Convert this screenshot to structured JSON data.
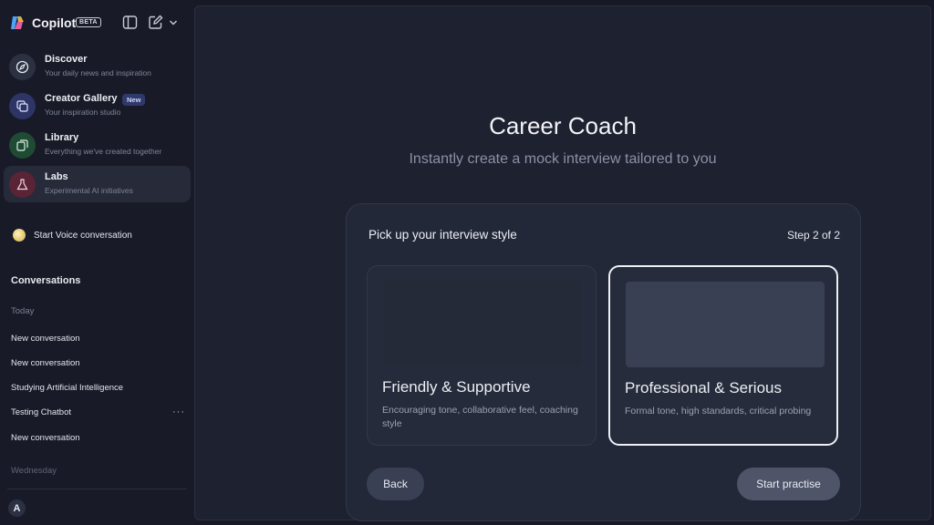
{
  "app": {
    "name": "Copilot",
    "badge": "BETA"
  },
  "toolbar": {
    "icons": [
      "sidebar-toggle-icon",
      "compose-icon",
      "chevron-down-icon"
    ]
  },
  "nav": [
    {
      "title": "Discover",
      "subtitle": "Your daily news and inspiration",
      "icon": "compass-icon",
      "color": "#2c3142"
    },
    {
      "title": "Creator Gallery",
      "subtitle": "Your inspiration studio",
      "icon": "gallery-icon",
      "color": "#2c3566",
      "badge": "New"
    },
    {
      "title": "Library",
      "subtitle": "Everything we've created together",
      "icon": "library-icon",
      "color": "#1f4a33"
    },
    {
      "title": "Labs",
      "subtitle": "Experimental AI initiatives",
      "icon": "flask-icon",
      "color": "#5a2436",
      "active": true
    }
  ],
  "voice": {
    "label": "Start Voice conversation"
  },
  "conversations": {
    "title": "Conversations",
    "groups": [
      {
        "label": "Today",
        "items": [
          "New conversation",
          "New conversation",
          "Studying Artificial Intelligence",
          "Testing Chatbot",
          "New conversation"
        ]
      },
      {
        "label": "Wednesday",
        "items": []
      }
    ],
    "more_label": "···"
  },
  "user": {
    "avatar_initial": "A"
  },
  "main": {
    "title": "Career Coach",
    "subtitle": "Instantly create a mock interview tailored to you",
    "card": {
      "title": "Pick up your interview style",
      "step": "Step 2 of 2",
      "options": [
        {
          "title": "Friendly & Supportive",
          "description": "Encouraging tone, collaborative feel, coaching style",
          "selected": false
        },
        {
          "title": "Professional & Serious",
          "description": "Formal tone, high standards, critical probing",
          "selected": true
        }
      ],
      "back_label": "Back",
      "start_label": "Start practise"
    }
  },
  "colors": {
    "background": "#171a26",
    "panel": "#1d2130",
    "card": "#232838",
    "selected_border": "#eef0f5"
  }
}
